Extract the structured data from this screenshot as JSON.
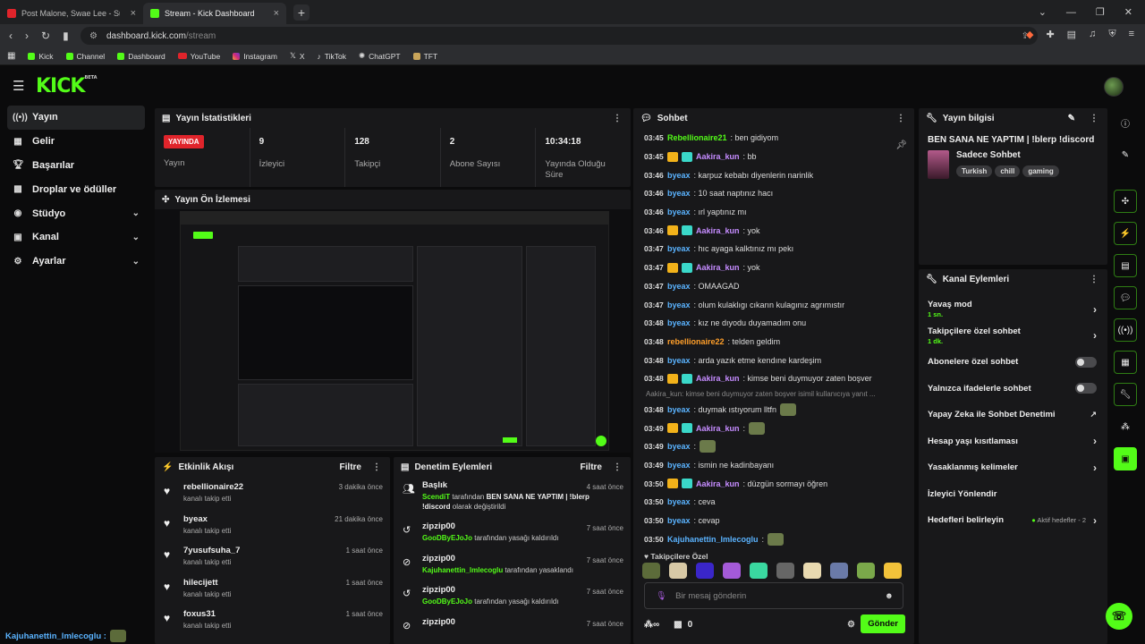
{
  "browser": {
    "tabs": [
      {
        "title": "Post Malone, Swae Lee - Sunflower (",
        "color": "#e0242b"
      },
      {
        "title": "Stream - Kick Dashboard",
        "color": "#53fc18"
      }
    ],
    "new_tab": "+",
    "url_host": "dashboard.kick.com",
    "url_path": "/stream",
    "bookmarks": [
      "Kick",
      "Channel",
      "Dashboard",
      "YouTube",
      "Instagram",
      "X",
      "TikTok",
      "ChatGPT",
      "TFT"
    ]
  },
  "brand": {
    "logo": "KICK",
    "beta": "BETA",
    "accent": "#53fc18"
  },
  "sidebar": {
    "items": [
      {
        "label": "Yayın",
        "icon": "broadcast-icon",
        "active": true
      },
      {
        "label": "Gelir",
        "icon": "revenue-icon"
      },
      {
        "label": "Başarılar",
        "icon": "trophy-icon"
      },
      {
        "label": "Droplar ve ödüller",
        "icon": "gift-icon"
      },
      {
        "label": "Stüdyo",
        "icon": "studio-icon",
        "chevron": true
      },
      {
        "label": "Kanal",
        "icon": "channel-icon",
        "chevron": true
      },
      {
        "label": "Ayarlar",
        "icon": "gear-icon",
        "chevron": true
      }
    ]
  },
  "stats": {
    "title": "Yayın İstatistikleri",
    "live_badge": "YAYINDA",
    "live_label": "Yayın",
    "viewers_value": "9",
    "viewers_label": "İzleyici",
    "followers_value": "128",
    "followers_label": "Takipçi",
    "subs_value": "2",
    "subs_label": "Abone Sayısı",
    "uptime_value": "10:34:18",
    "uptime_label": "Yayında Olduğu Süre"
  },
  "preview": {
    "title": "Yayın Ön İzlemesi"
  },
  "activity": {
    "title": "Etkinlik Akışı",
    "filter": "Filtre",
    "items": [
      {
        "name": "rebellionaire22",
        "sub": "kanalı takip etti",
        "time": "3 dakika önce"
      },
      {
        "name": "byeax",
        "sub": "kanalı takip etti",
        "time": "21 dakika önce"
      },
      {
        "name": "7yusufsuha_7",
        "sub": "kanalı takip etti",
        "time": "1 saat önce"
      },
      {
        "name": "hilecijett",
        "sub": "kanalı takip etti",
        "time": "1 saat önce"
      },
      {
        "name": "foxus31",
        "sub": "kanalı takip etti",
        "time": "1 saat önce"
      }
    ]
  },
  "moderation": {
    "title": "Denetim Eylemleri",
    "filter": "Filtre",
    "items": [
      {
        "name": "Başlık",
        "actor": "ScendiT",
        "text1": " tarafından ",
        "bold": "BEN SANA NE YAPTIM | !blerp !discord",
        "text2": " olarak değiştirildi",
        "time": "4 saat önce",
        "icon": "title-change-icon"
      },
      {
        "name": "zipzip00",
        "actor": "GooDByEJoJo",
        "text1": " tarafından yasağı kaldırıldı",
        "bold": "",
        "text2": "",
        "time": "7 saat önce",
        "icon": "unban-icon"
      },
      {
        "name": "zipzip00",
        "actor": "Kajuhanettin_lmlecoglu",
        "text1": " tarafından yasaklandı",
        "bold": "",
        "text2": "",
        "time": "7 saat önce",
        "icon": "ban-icon"
      },
      {
        "name": "zipzip00",
        "actor": "GooDByEJoJo",
        "text1": " tarafından yasağı kaldırıldı",
        "bold": "",
        "text2": "",
        "time": "7 saat önce",
        "icon": "unban-icon"
      },
      {
        "name": "zipzip00",
        "actor": "",
        "text1": "",
        "bold": "",
        "text2": "",
        "time": "7 saat önce",
        "icon": "ban-icon"
      }
    ]
  },
  "chat": {
    "title": "Sohbet",
    "messages": [
      {
        "time": "03:45",
        "user": "Rebellionaire21",
        "color": "#53fc18",
        "text": ": ben gidiyom"
      },
      {
        "time": "03:45",
        "user": "Aakira_kun",
        "color": "#c58cff",
        "badges": true,
        "text": ": bb"
      },
      {
        "time": "03:46",
        "user": "byeax",
        "color": "#5ab3ff",
        "text": ": karpuz kebabı diyenlerin narinlik"
      },
      {
        "time": "03:46",
        "user": "byeax",
        "color": "#5ab3ff",
        "text": ": 10 saat naptınız hacı"
      },
      {
        "time": "03:46",
        "user": "byeax",
        "color": "#5ab3ff",
        "text": ": ırl yaptınız mı"
      },
      {
        "time": "03:46",
        "user": "Aakira_kun",
        "color": "#c58cff",
        "badges": true,
        "text": ": yok"
      },
      {
        "time": "03:47",
        "user": "byeax",
        "color": "#5ab3ff",
        "text": ": hıc ayaga kalktınız mı pekı"
      },
      {
        "time": "03:47",
        "user": "Aakira_kun",
        "color": "#c58cff",
        "badges": true,
        "text": ": yok"
      },
      {
        "time": "03:47",
        "user": "byeax",
        "color": "#5ab3ff",
        "text": ": OMAAGAD"
      },
      {
        "time": "03:47",
        "user": "byeax",
        "color": "#5ab3ff",
        "text": ": olum kulaklıgı cıkarın kulagınız agrımıstır"
      },
      {
        "time": "03:48",
        "user": "byeax",
        "color": "#5ab3ff",
        "text": ": kız ne dıyodu duyamadım onu"
      },
      {
        "time": "03:48",
        "user": "rebellionaire22",
        "color": "#ff9f2a",
        "text": ": telden geldim"
      },
      {
        "time": "03:48",
        "user": "byeax",
        "color": "#5ab3ff",
        "text": ": arda yazık etme kendıne kardeşim"
      },
      {
        "time": "03:48",
        "user": "Aakira_kun",
        "color": "#c58cff",
        "badges": true,
        "text": ": kimse beni duymuyor zaten boşver"
      }
    ],
    "reply": "Aakira_kun: kimse beni duymuyor zaten boşver isimil kullanıcıya yanıt ...",
    "messages2": [
      {
        "time": "03:48",
        "user": "byeax",
        "color": "#5ab3ff",
        "text": ": duymak ıstıyorum lltfn",
        "emote": true
      },
      {
        "time": "03:49",
        "user": "Aakira_kun",
        "color": "#c58cff",
        "badges": true,
        "text": ":",
        "emote": true
      },
      {
        "time": "03:49",
        "user": "byeax",
        "color": "#5ab3ff",
        "text": ":",
        "emote": true
      },
      {
        "time": "03:49",
        "user": "byeax",
        "color": "#5ab3ff",
        "text": ": ismin ne kadinbayanı"
      },
      {
        "time": "03:50",
        "user": "Aakira_kun",
        "color": "#c58cff",
        "badges": true,
        "text": ": düzgün sormayı öğren"
      },
      {
        "time": "03:50",
        "user": "byeax",
        "color": "#5ab3ff",
        "text": ": ceva"
      },
      {
        "time": "03:50",
        "user": "byeax",
        "color": "#5ab3ff",
        "text": ": cevap"
      },
      {
        "time": "03:50",
        "user": "Kajuhanettin_lmlecoglu",
        "color": "#5ab3ff",
        "text": ":",
        "emote": true
      }
    ],
    "followers_only": "Takipçilere Özel",
    "input_placeholder": "Bir mesaj gönderin",
    "points": "0",
    "send": "Gönder"
  },
  "stream_info": {
    "title": "Yayın bilgisi",
    "stream_title": "BEN SANA NE YAPTIM | !blerp !discord",
    "category": "Sadece Sohbet",
    "tags": [
      "Turkish",
      "chill",
      "gaming"
    ]
  },
  "channel_actions": {
    "title": "Kanal Eylemleri",
    "items": [
      {
        "label": "Yavaş mod",
        "sub": "1 sn.",
        "kind": "arrow"
      },
      {
        "label": "Takipçilere özel sohbet",
        "sub": "1 dk.",
        "kind": "arrow"
      },
      {
        "label": "Abonelere özel sohbet",
        "sub": "",
        "kind": "toggle"
      },
      {
        "label": "Yalnızca ifadelerle sohbet",
        "sub": "",
        "kind": "toggle"
      },
      {
        "label": "Yapay Zeka ile Sohbet Denetimi",
        "sub": "",
        "kind": "external"
      },
      {
        "label": "Hesap yaşı kısıtlaması",
        "sub": "",
        "kind": "arrow"
      },
      {
        "label": "Yasaklanmış kelimeler",
        "sub": "",
        "kind": "arrow"
      },
      {
        "label": "İzleyici Yönlendir",
        "sub": "",
        "kind": "none"
      },
      {
        "label": "Hedefleri belirleyin",
        "sub": "",
        "kind": "arrow",
        "status": "Aktif hedefler - 2"
      }
    ]
  },
  "bottom_user": "Kajuhanettin_lmlecoglu :"
}
